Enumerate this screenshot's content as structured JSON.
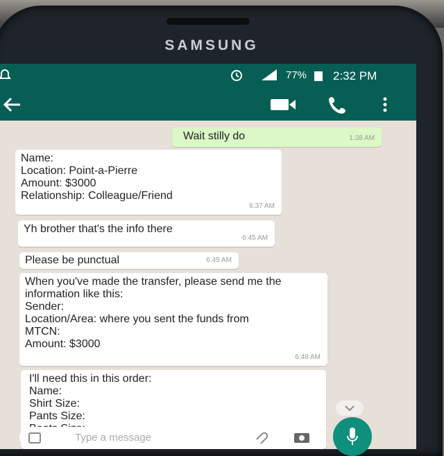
{
  "device": {
    "brand": "SAMSUNG"
  },
  "status_bar": {
    "battery": "77%",
    "time": "2:32 PM"
  },
  "colors": {
    "header": "#075e54",
    "incoming": "#ffffff",
    "outgoing": "#dcf8c6",
    "mic": "#0f8f7c",
    "background": "#e6e0d9"
  },
  "icons": [
    "back-arrow-icon",
    "video-call-icon",
    "phone-icon",
    "more-vert-icon",
    "alarm-icon",
    "signal-icon",
    "battery-icon",
    "emoji-icon",
    "attach-icon",
    "camera-icon",
    "mic-icon"
  ],
  "messages": [
    {
      "type": "outgoing",
      "text": "Wait stilly do",
      "time": "1:38 AM"
    },
    {
      "type": "incoming",
      "text": "Name:\nLocation: Point-a-Pierre\nAmount: $3000\nRelationship: Colleague/Friend",
      "time": "6:37 AM"
    },
    {
      "type": "incoming",
      "text": "Yh brother that's the info there",
      "time": "6:45 AM"
    },
    {
      "type": "incoming",
      "text": "Please be punctual",
      "time": "6:45 AM"
    },
    {
      "type": "incoming",
      "text": "When you've made the transfer, please send me the information like this:\nSender:\nLocation/Area: where you sent the funds from\nMTCN:\nAmount: $3000",
      "time": "6:48 AM"
    },
    {
      "type": "incoming",
      "text": "I'll need this in this order:\nName:\nShirt Size:\nPants Size:\nBoots Size:\nColor of Outfit:",
      "time": ""
    }
  ],
  "input": {
    "placeholder": "Type a message"
  }
}
